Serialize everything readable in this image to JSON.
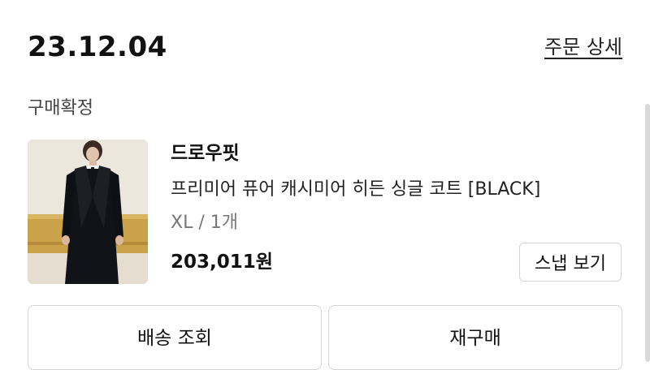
{
  "order": {
    "date": "23.12.04",
    "detail_link": "주문 상세",
    "status": "구매확정"
  },
  "item": {
    "brand": "드로우핏",
    "name": "프리미어 퓨어 캐시미어 히든 싱글 코트 [BLACK]",
    "option": "XL / 1개",
    "price": "203,011원",
    "image": "black-long-coat-model-photo",
    "snap_button": "스냅 보기"
  },
  "actions": {
    "track_delivery": "배송 조회",
    "reorder": "재구매"
  },
  "colors": {
    "text_primary": "#111111",
    "text_secondary": "#777777",
    "border": "#d4d4d4"
  }
}
